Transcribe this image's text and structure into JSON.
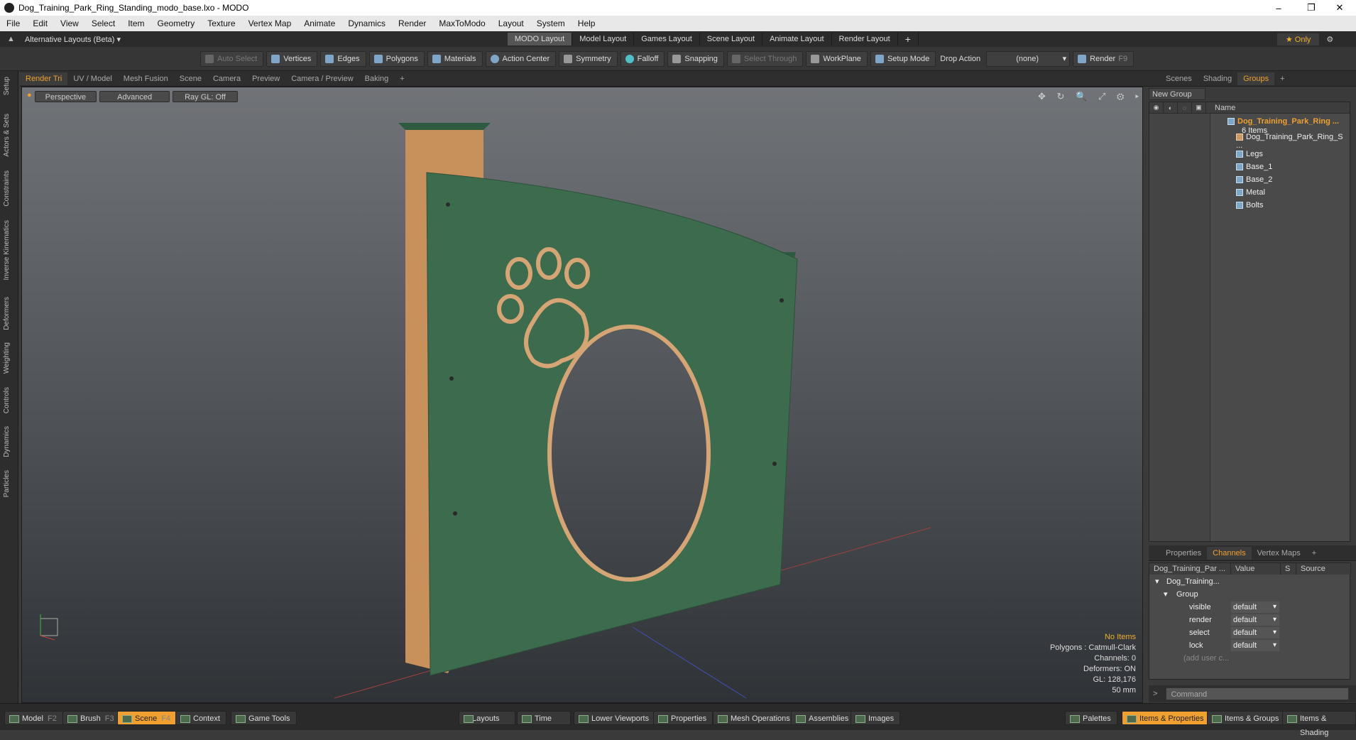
{
  "window": {
    "title": "Dog_Training_Park_Ring_Standing_modo_base.lxo - MODO",
    "min": "–",
    "max": "❐",
    "close": "✕"
  },
  "menu": [
    "File",
    "Edit",
    "View",
    "Select",
    "Item",
    "Geometry",
    "Texture",
    "Vertex Map",
    "Animate",
    "Dynamics",
    "Render",
    "MaxToModo",
    "Layout",
    "System",
    "Help"
  ],
  "layoutbar": {
    "alt": "Alternative Layouts (Beta) ▾",
    "tabs": [
      "MODO Layout",
      "Model Layout",
      "Games Layout",
      "Scene Layout",
      "Animate Layout",
      "Render Layout"
    ],
    "plus": "+",
    "only": "★  Only"
  },
  "toolbar": {
    "auto_select": "Auto Select",
    "vertices": "Vertices",
    "edges": "Edges",
    "polygons": "Polygons",
    "materials": "Materials",
    "action_center": "Action Center",
    "symmetry": "Symmetry",
    "falloff": "Falloff",
    "snapping": "Snapping",
    "select_through": "Select Through",
    "workplane": "WorkPlane",
    "setup_mode": "Setup Mode",
    "drop_action": "Drop Action",
    "drop_value": "(none)",
    "render": "Render",
    "render_key": "F9"
  },
  "left_tabs": [
    "Setup",
    "Actors & Sets",
    "Constraints",
    "Inverse Kinematics",
    "Deformers",
    "Weighting",
    "Controls",
    "Dynamics",
    "Particles"
  ],
  "viewport_tabs": [
    "Render Tri",
    "UV / Model",
    "Mesh Fusion",
    "Scene",
    "Camera",
    "Preview",
    "Camera / Preview",
    "Baking",
    "+"
  ],
  "viewport_opts": {
    "view": "Perspective",
    "shading": "Advanced",
    "raygl": "Ray GL: Off"
  },
  "viewport_icons": "✥ ↻ 🔍 ⤢ ⚙ ▸",
  "stats": {
    "items": "No Items",
    "polygons": "Polygons : Catmull-Clark",
    "channels": "Channels: 0",
    "deformers": "Deformers: ON",
    "gl": "GL: 128,176",
    "unit": "50 mm"
  },
  "right_tabs": [
    "Scenes",
    "Shading",
    "Groups",
    "+"
  ],
  "groups": {
    "new_group": "New Group",
    "col_name": "Name",
    "root": "Dog_Training_Park_Ring ...",
    "root_count": "6 Items",
    "children": [
      "Dog_Training_Park_Ring_S ...",
      "Legs",
      "Base_1",
      "Base_2",
      "Metal",
      "Bolts"
    ]
  },
  "props_tabs": [
    "Properties",
    "Channels",
    "Vertex Maps",
    "+"
  ],
  "channels": {
    "h_name": "Dog_Training_Par ...",
    "h_value": "Value",
    "h_s": "S",
    "h_source": "Source",
    "item": "Dog_Training...",
    "group": "Group",
    "rows": [
      {
        "name": "visible",
        "value": "default"
      },
      {
        "name": "render",
        "value": "default"
      },
      {
        "name": "select",
        "value": "default"
      },
      {
        "name": "lock",
        "value": "default"
      }
    ],
    "add": "(add user c..."
  },
  "command": {
    "placeholder": "Command"
  },
  "statusbar": {
    "model": "Model",
    "model_key": "F2",
    "brush": "Brush",
    "brush_key": "F3",
    "scene": "Scene",
    "scene_key": "F4",
    "context": "Context",
    "game_tools": "Game Tools",
    "layouts": "Layouts",
    "time": "Time",
    "lower_viewports": "Lower Viewports",
    "properties": "Properties",
    "mesh_ops": "Mesh Operations",
    "assemblies": "Assemblies",
    "images": "Images",
    "palettes": "Palettes",
    "items_props": "Items & Properties",
    "items_groups": "Items & Groups",
    "items_shading": "Items & Shading"
  },
  "colors": {
    "accent": "#f0a030",
    "panel_green": "#3d6b4e",
    "wood": "#c8905a"
  }
}
